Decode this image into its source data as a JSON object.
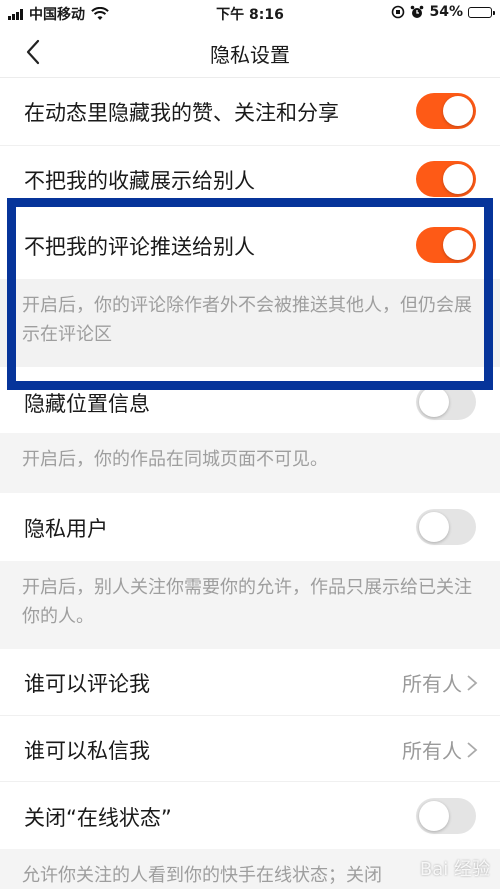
{
  "status_bar": {
    "carrier": "中国移动",
    "time": "下午 8:16",
    "battery": "54%",
    "battery_level": 0.54
  },
  "nav": {
    "title": "隐私设置"
  },
  "settings": [
    {
      "label": "在动态里隐藏我的赞、关注和分享",
      "on": true
    },
    {
      "label": "不把我的收藏展示给别人",
      "on": true
    },
    {
      "label": "不把我的评论推送给别人",
      "on": true,
      "desc": "开启后，你的评论除作者外不会被推送其他人，但仍会展示在评论区"
    },
    {
      "label": "隐藏位置信息",
      "on": false,
      "desc": "开启后，你的作品在同城页面不可见。"
    },
    {
      "label": "隐私用户",
      "on": false,
      "desc": "开启后，别人关注你需要你的允许，作品只展示给已关注你的人。"
    },
    {
      "label": "谁可以评论我",
      "value": "所有人"
    },
    {
      "label": "谁可以私信我",
      "value": "所有人"
    },
    {
      "label": "关闭“在线状态”",
      "on": false,
      "desc": "允许你关注的人看到你的快手在线状态；关闭"
    }
  ],
  "colors": {
    "accent": "#fe5a16",
    "highlight": "#06349a"
  },
  "watermark": "Bai 经验"
}
